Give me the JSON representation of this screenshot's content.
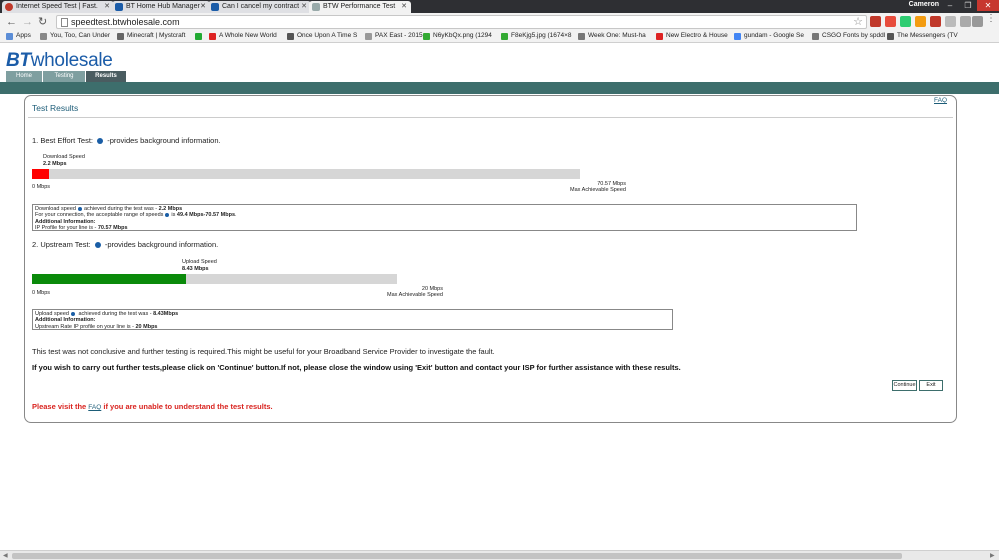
{
  "browser": {
    "tabs": [
      {
        "title": "Internet Speed Test | Fast.",
        "icon": "red-circle-favicon",
        "color": "#c0392b"
      },
      {
        "title": "BT Home Hub Manager -",
        "icon": "bt-favicon",
        "color": "#1b5ca8"
      },
      {
        "title": "Can I cancel my contract",
        "icon": "bt-favicon",
        "color": "#1b5ca8"
      },
      {
        "title": "BTW Performance Test",
        "icon": "page-favicon",
        "color": "#9aa"
      }
    ],
    "user": "Cameron",
    "url": "speedtest.btwholesale.com",
    "bookmarks": [
      {
        "label": "Apps",
        "color": "#5b8dd6"
      },
      {
        "label": "You, Too, Can Under",
        "color": "#888"
      },
      {
        "label": "Minecraft | Mystcraft",
        "color": "#666"
      },
      {
        "label": "",
        "color": "#2a3"
      },
      {
        "label": "A Whole New World",
        "color": "#d22"
      },
      {
        "label": "Once Upon A Time S",
        "color": "#555"
      },
      {
        "label": "PAX East - 2015",
        "color": "#999"
      },
      {
        "label": "N6yKbQx.png (1294",
        "color": "#3a3"
      },
      {
        "label": "F8eKjg5.jpg (1674×8",
        "color": "#3a3"
      },
      {
        "label": "Week One: Must-ha",
        "color": "#777"
      },
      {
        "label": "New Electro & House",
        "color": "#d22"
      },
      {
        "label": "gundam - Google Se",
        "color": "#4285f4"
      },
      {
        "label": "CSGO Fonts by spddl",
        "color": "#777"
      },
      {
        "label": "The Messengers (TV",
        "color": "#555"
      }
    ]
  },
  "site": {
    "logo_bt": "BT",
    "logo_rest": "wholesale",
    "nav": [
      {
        "label": "Home",
        "active": false
      },
      {
        "label": "Testing",
        "active": false
      },
      {
        "label": "Results",
        "active": true
      }
    ]
  },
  "results": {
    "title": "Test Results",
    "faq_link": "FAQ",
    "download": {
      "heading_before": "1. Best Effort Test:",
      "heading_after": "-provides background information.",
      "label": "Download Speed",
      "value": "2.2 Mbps",
      "min_label": "0 Mbps",
      "max_value": "70.57 Mbps",
      "max_label": "Max Achievable Speed",
      "speed_mbps": 2.2,
      "max_mbps": 70.57,
      "bar_color": "#ff0000",
      "box_line1_a": "Download speed",
      "box_line1_b": "achieved during the test was - ",
      "box_line1_val": "2.2 Mbps",
      "box_line2_a": "For your connection, the acceptable range of speeds",
      "box_line2_b": "is ",
      "box_line2_val": "49.4 Mbps-70.57 Mbps",
      "box_line2_end": ".",
      "box_line3": "Additional Information:",
      "box_line4_a": "IP Profile for your line is - ",
      "box_line4_val": "70.57 Mbps"
    },
    "upload": {
      "heading_before": "2. Upstream Test:",
      "heading_after": "-provides background information.",
      "label": "Upload Speed",
      "value": "8.43 Mbps",
      "min_label": "0 Mbps",
      "max_value": "20 Mbps",
      "max_label": "Max Achievable Speed",
      "speed_mbps": 8.43,
      "max_mbps": 20,
      "bar_color": "#0a8a0a",
      "box_line1_a": "Upload speed",
      "box_line1_b": " achieved during the test was - ",
      "box_line1_val": "8.43Mbps",
      "box_line2": "Additional Information:",
      "box_line3_a": "Upstream Rate IP profile on your line is - ",
      "box_line3_val": "20 Mbps"
    },
    "note": "This test was not conclusive and further testing is required.This might be useful for your Broadband Service Provider to investigate the fault.",
    "instruction": "If you wish to carry out further tests,please click on 'Continue' button.If not, please close the window using 'Exit' button and contact your ISP for further assistance with these results.",
    "continue_label": "Continue",
    "exit_label": "Exit",
    "visit_before": "Please visit the ",
    "visit_link": "FAQ",
    "visit_after": " if you are unable to understand the test results."
  }
}
